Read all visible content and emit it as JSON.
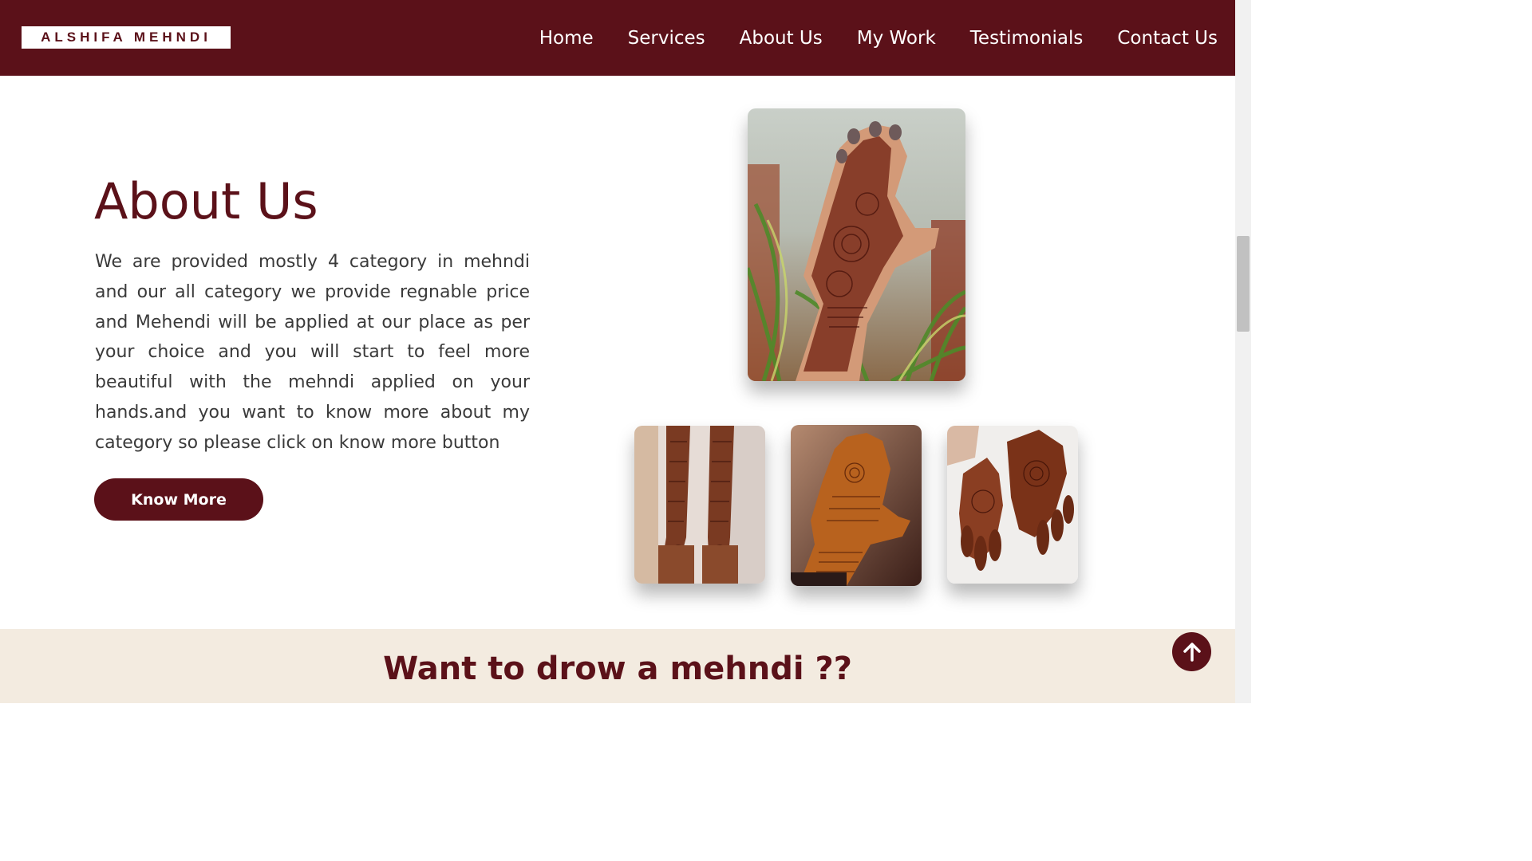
{
  "brand": {
    "logo_text": "ALSHIFA MEHNDI"
  },
  "nav": {
    "items": [
      {
        "label": "Home"
      },
      {
        "label": "Services"
      },
      {
        "label": "About Us"
      },
      {
        "label": "My Work"
      },
      {
        "label": "Testimonials"
      },
      {
        "label": "Contact Us"
      }
    ]
  },
  "about": {
    "title": "About Us",
    "body": "We are provided mostly 4 category in mehndi and our all category we provide regnable price and Mehendi will be applied at our place as per your choice and you will start to feel more beautiful with the mehndi applied on your hands.and you want to know more about my category so please click on know more button",
    "button_label": "Know More"
  },
  "gallery": {
    "images": [
      {
        "subject": "hand-with-mehndi-over-plant"
      },
      {
        "subject": "two-arms-bridal-mehndi"
      },
      {
        "subject": "hand-mehndi-brown-background"
      },
      {
        "subject": "two-palms-mehndi-white-cloth"
      }
    ]
  },
  "cta": {
    "title": "Want to drow a mehndi ??"
  },
  "icons": {
    "scroll_top": "arrow-up-icon"
  },
  "colors": {
    "brand": "#5b1119",
    "cta_background": "#f3ebe0",
    "text": "#3a3a3a"
  }
}
